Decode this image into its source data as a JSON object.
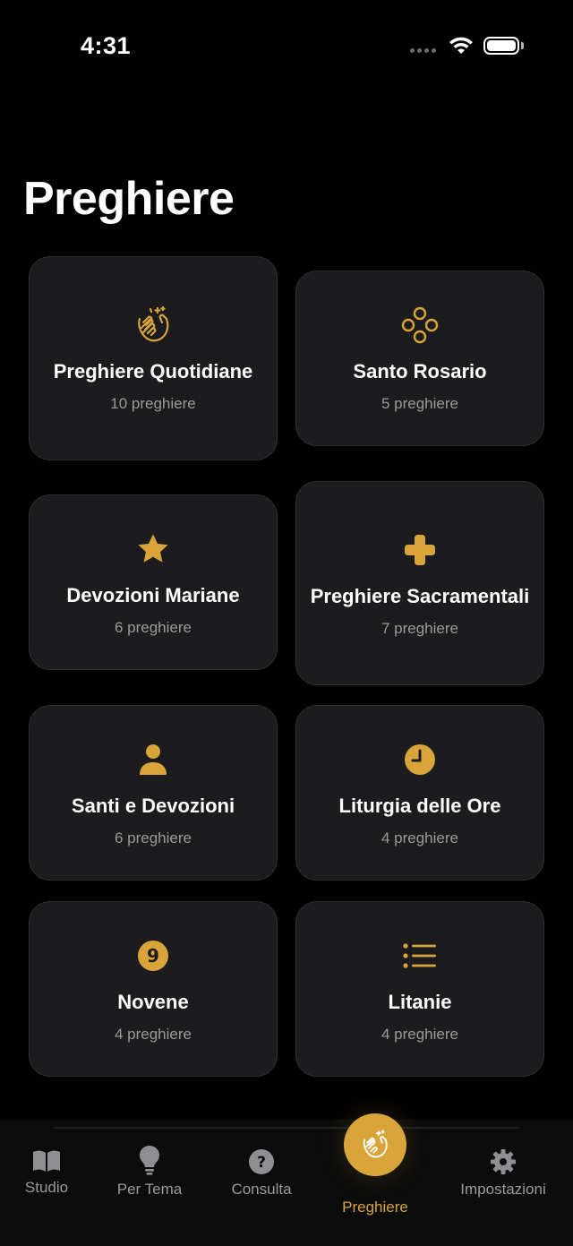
{
  "status_bar": {
    "time": "4:31"
  },
  "header": {
    "title": "Preghiere"
  },
  "accent_color": "#d9a53a",
  "categories": [
    {
      "title": "Preghiere Quotidiane",
      "count": "10 preghiere",
      "icon": "hands-clapping-icon"
    },
    {
      "title": "Santo Rosario",
      "count": "5 preghiere",
      "icon": "rosary-beads-icon"
    },
    {
      "title": "Devozioni Mariane",
      "count": "6 preghiere",
      "icon": "star-icon"
    },
    {
      "title": "Preghiere Sacramentali",
      "count": "7 preghiere",
      "icon": "cross-icon"
    },
    {
      "title": "Santi e Devozioni",
      "count": "6 preghiere",
      "icon": "person-icon"
    },
    {
      "title": "Liturgia delle Ore",
      "count": "4 preghiere",
      "icon": "clock-icon"
    },
    {
      "title": "Novene",
      "count": "4 preghiere",
      "icon": "number-nine-icon"
    },
    {
      "title": "Litanie",
      "count": "4 preghiere",
      "icon": "list-icon"
    }
  ],
  "tab_bar": {
    "items": [
      {
        "label": "Studio",
        "icon": "book-icon"
      },
      {
        "label": "Per Tema",
        "icon": "lightbulb-icon"
      },
      {
        "label": "Consulta",
        "icon": "question-icon"
      },
      {
        "label": "Preghiere",
        "icon": "hands-clapping-icon",
        "active": true
      },
      {
        "label": "Impostazioni",
        "icon": "gear-icon"
      }
    ]
  }
}
